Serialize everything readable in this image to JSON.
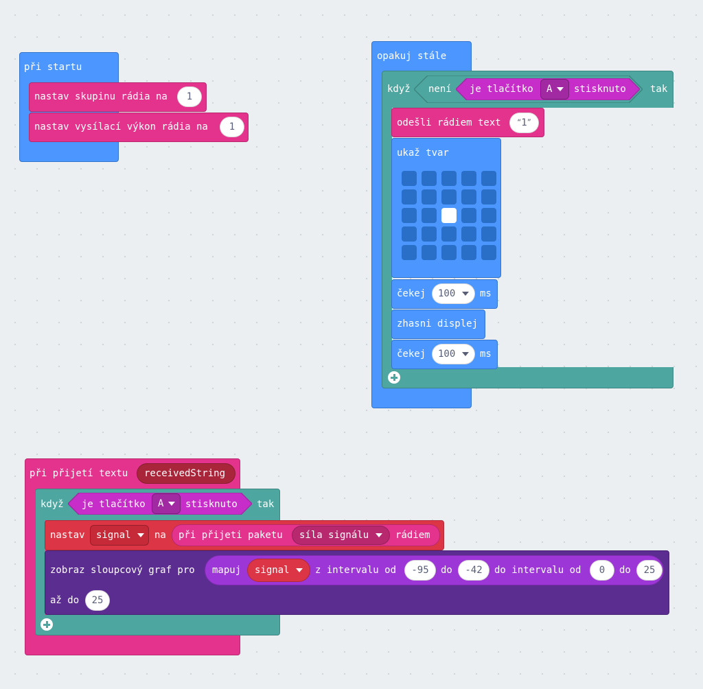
{
  "colors": {
    "basic": "#4c97ff",
    "radio": "#e3338c",
    "logic": "#4da69f",
    "input": "#c72ec9",
    "variables": "#dc3545",
    "led": "#5c2d91",
    "math": "#9d36d6"
  },
  "on_start": {
    "title": "při startu",
    "set_group_label": "nastav skupinu rádia na",
    "set_group_value": "1",
    "set_power_label": "nastav vysílací výkon rádia na",
    "set_power_value": "1"
  },
  "forever": {
    "title": "opakuj stále",
    "if_label": "když",
    "not_label": "není",
    "button_label": "je tlačítko",
    "button_value": "A",
    "pressed_label": "stisknuto",
    "then_label": "tak",
    "send_label": "odešli rádiem text",
    "send_value": "1",
    "show_leds_label": "ukaž tvar",
    "leds": [
      [
        0,
        0,
        0,
        0,
        0
      ],
      [
        0,
        0,
        0,
        0,
        0
      ],
      [
        0,
        0,
        1,
        0,
        0
      ],
      [
        0,
        0,
        0,
        0,
        0
      ],
      [
        0,
        0,
        0,
        0,
        0
      ]
    ],
    "pause1_label": "čekej",
    "pause1_value": "100",
    "pause1_unit": "ms",
    "clear_label": "zhasni displej",
    "pause2_label": "čekej",
    "pause2_value": "100",
    "pause2_unit": "ms",
    "add_icon": "plus-icon"
  },
  "on_received": {
    "title": "při přijetí textu",
    "param": "receivedString",
    "if_label": "když",
    "button_label": "je tlačítko",
    "button_value": "A",
    "pressed_label": "stisknuto",
    "then_label": "tak",
    "set_label": "nastav",
    "set_var": "signal",
    "set_to": "na",
    "packet_label": "při přijeti paketu",
    "packet_prop": "síla signálu",
    "packet_suffix": "rádiem",
    "plot_label": "zobraz sloupcový graf pro",
    "map_label": "mapuj",
    "map_var": "signal",
    "from_label": "z intervalu od",
    "from_low": "-95",
    "to_label": "do",
    "from_high": "-42",
    "to_interval_label": "do intervalu od",
    "to_low": "0",
    "to_label2": "do",
    "to_high": "25",
    "up_to_label": "až do",
    "up_to_value": "25",
    "add_icon": "plus-icon"
  }
}
